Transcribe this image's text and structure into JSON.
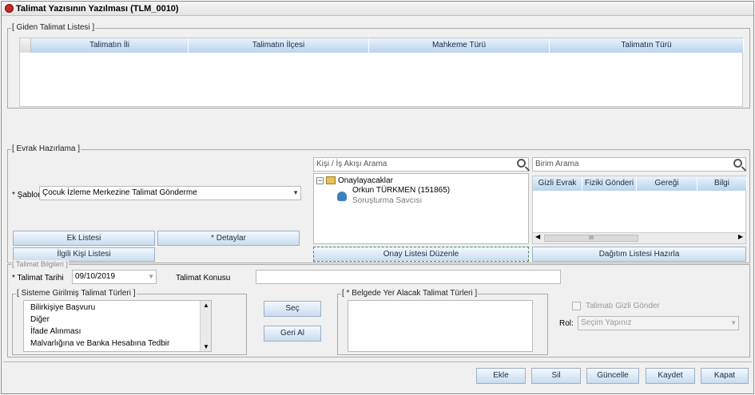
{
  "window": {
    "title": "Talimat Yazısının Yazılması (TLM_0010)"
  },
  "giden": {
    "legend": "[ Giden Talimat Listesi ]",
    "columns": [
      "Talimatın İli",
      "Talimatın İlçesi",
      "Mahkeme Türü",
      "Talimatın Türü"
    ]
  },
  "evrak": {
    "legend": "[ Evrak Hazırlama ]",
    "sablon_label": "* Şablon",
    "sablon_value": "Çocuk İzleme Merkezine Talimat Gönderme",
    "ek_listesi": "Ek Listesi",
    "detaylar": "* Detaylar",
    "ilgili_kisi": "İlgili Kişi Listesi",
    "kisi_search_placeholder": "Kişi / İş Akışı Arama",
    "tree_root": "Onaylayacaklar",
    "tree_person": "Orkun TÜRKMEN (151865)",
    "tree_role": "Soruşturma Savcısı",
    "onay_button": "Onay Listesi Düzenle",
    "birim_search_placeholder": "Birim Arama",
    "birim_columns": [
      "Gizli Evrak",
      "Fiziki Gönderi",
      "Gereği",
      "Bilgi"
    ],
    "scroll_mark": "III",
    "dagitim_button": "Dağıtım Listesi Hazırla"
  },
  "talimat": {
    "legend": "[ Talimat Bilgileri ]",
    "tarih_label": "* Talimat Tarihi",
    "tarih_value": "09/10/2019",
    "konu_label": "Talimat Konusu",
    "sistem_legend": "[ Sisteme Girilmiş Talimat Türleri ]",
    "sistem_items": [
      "Bilirkişiye Başvuru",
      "Diğer",
      "İfade Alınması",
      "Malvarlığına ve Banka Hesabına Tedbir"
    ],
    "sec_button": "Seç",
    "geri_button": "Geri Al",
    "belgede_legend": "[ * Belgede Yer Alacak Talimat Türleri ]",
    "gizli_label": "Talimatı Gizli Gönder",
    "rol_label": "Rol:",
    "rol_placeholder": "Seçim Yapınız"
  },
  "footer": {
    "ekle": "Ekle",
    "sil": "Sil",
    "guncelle": "Güncelle",
    "kaydet": "Kaydet",
    "kapat": "Kapat"
  }
}
